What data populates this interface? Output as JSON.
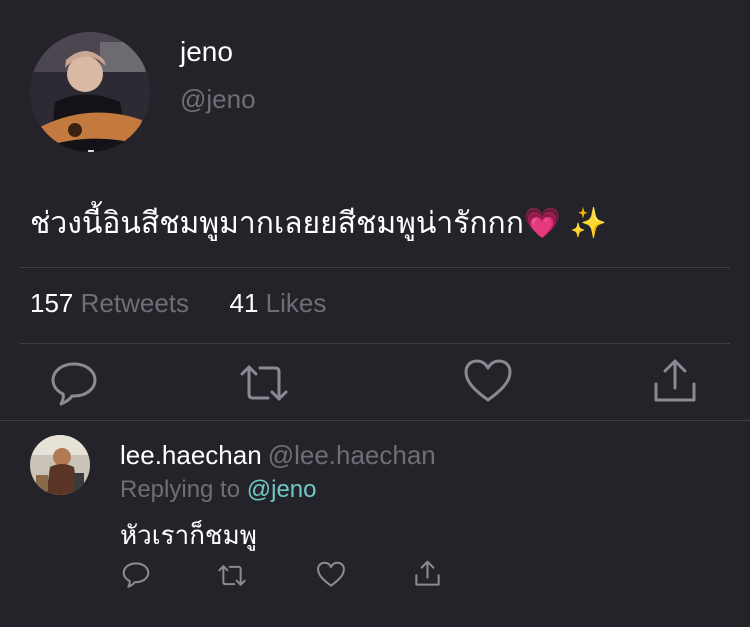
{
  "tweet": {
    "author_name": "jeno",
    "author_handle": "@jeno",
    "text": "ช่วงนี้อินสีชมพูมากเลยยสีชมพูน่ารักกก💗 ✨",
    "retweets_count": "157",
    "retweets_label": "Retweets",
    "likes_count": "41",
    "likes_label": "Likes"
  },
  "actions": {
    "reply_icon": "comment-icon",
    "retweet_icon": "retweet-icon",
    "like_icon": "heart-icon",
    "share_icon": "share-icon"
  },
  "reply": {
    "author_name": "lee.haechan",
    "author_handle": "@lee.haechan",
    "replying_label": "Replying to",
    "replying_to": "@jeno",
    "text": "หัวเราก็ชมพู"
  },
  "colors": {
    "background": "#232329",
    "secondary_text": "#6e6f76",
    "accent": "#6ec9c5",
    "divider": "#3f4047",
    "icon": "#8a8b92"
  }
}
